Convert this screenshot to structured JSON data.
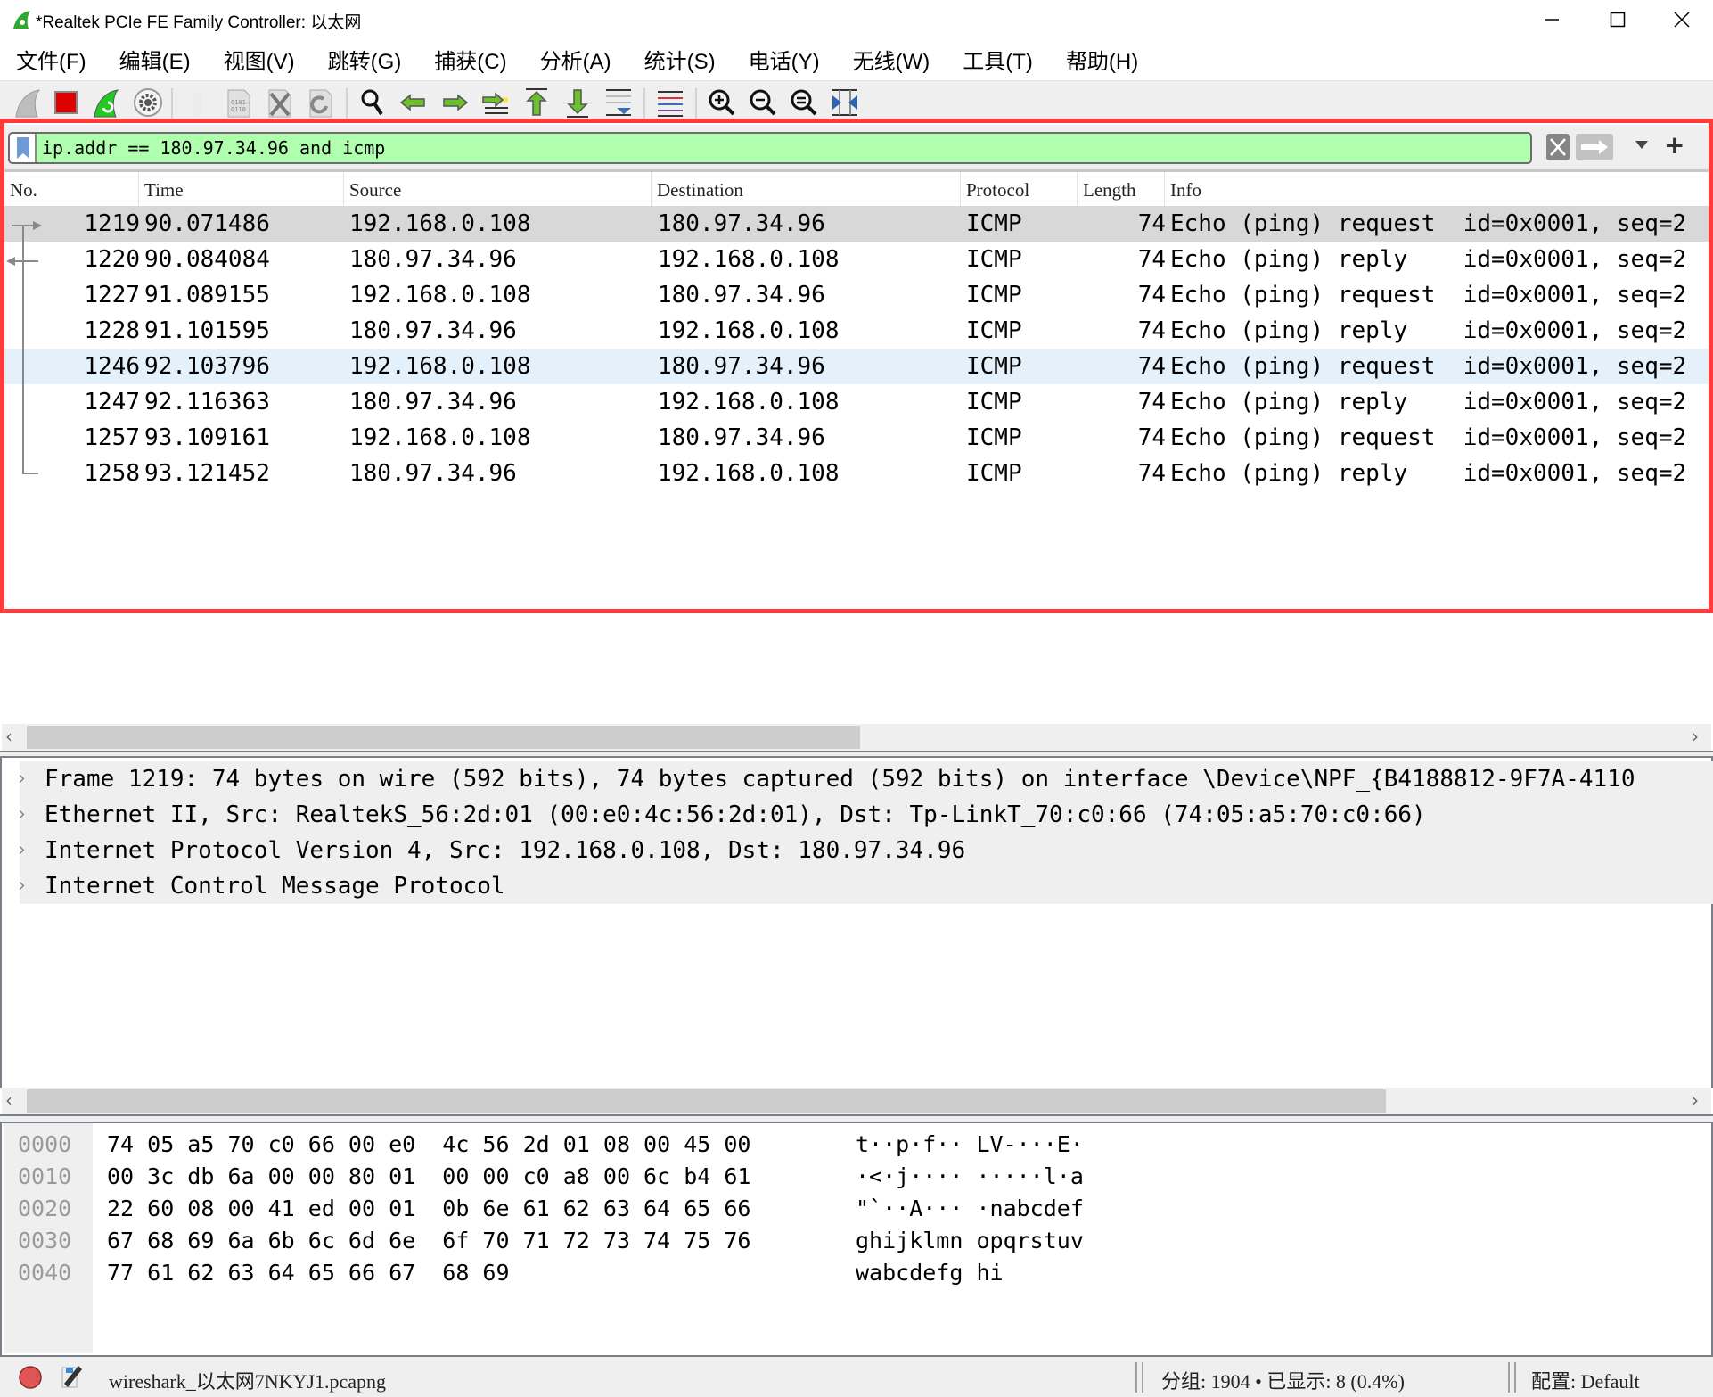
{
  "window": {
    "title": "*Realtek PCIe FE Family Controller: 以太网",
    "controls": {
      "minimize": "minimize",
      "maximize": "maximize",
      "close": "close"
    }
  },
  "menu": [
    {
      "label": "文件(F)"
    },
    {
      "label": "编辑(E)"
    },
    {
      "label": "视图(V)"
    },
    {
      "label": "跳转(G)"
    },
    {
      "label": "捕获(C)"
    },
    {
      "label": "分析(A)"
    },
    {
      "label": "统计(S)"
    },
    {
      "label": "电话(Y)"
    },
    {
      "label": "无线(W)"
    },
    {
      "label": "工具(T)"
    },
    {
      "label": "帮助(H)"
    }
  ],
  "toolbar": {
    "icons": [
      "start-capture-icon",
      "stop-capture-icon",
      "restart-capture-icon",
      "capture-options-icon",
      "open-file-icon",
      "save-file-icon",
      "close-file-icon",
      "reload-file-icon",
      "find-packet-icon",
      "go-back-icon",
      "go-forward-icon",
      "go-to-packet-icon",
      "go-first-packet-icon",
      "go-last-packet-icon",
      "auto-scroll-icon",
      "colorize-icon",
      "zoom-in-icon",
      "zoom-out-icon",
      "zoom-normal-icon",
      "resize-columns-icon"
    ]
  },
  "filter": {
    "value": "ip.addr == 180.97.34.96 and icmp",
    "bg_color": "#afffaf",
    "add_label": "+"
  },
  "packet_list": {
    "columns": [
      "No.",
      "Time",
      "Source",
      "Destination",
      "Protocol",
      "Length",
      "Info"
    ],
    "rows": [
      {
        "no": "1219",
        "time": "90.071486",
        "src": "192.168.0.108",
        "dst": "180.97.34.96",
        "proto": "ICMP",
        "len": "74",
        "info": "Echo (ping) request  id=0x0001, seq=2"
      },
      {
        "no": "1220",
        "time": "90.084084",
        "src": "180.97.34.96",
        "dst": "192.168.0.108",
        "proto": "ICMP",
        "len": "74",
        "info": "Echo (ping) reply    id=0x0001, seq=2"
      },
      {
        "no": "1227",
        "time": "91.089155",
        "src": "192.168.0.108",
        "dst": "180.97.34.96",
        "proto": "ICMP",
        "len": "74",
        "info": "Echo (ping) request  id=0x0001, seq=2"
      },
      {
        "no": "1228",
        "time": "91.101595",
        "src": "180.97.34.96",
        "dst": "192.168.0.108",
        "proto": "ICMP",
        "len": "74",
        "info": "Echo (ping) reply    id=0x0001, seq=2"
      },
      {
        "no": "1246",
        "time": "92.103796",
        "src": "192.168.0.108",
        "dst": "180.97.34.96",
        "proto": "ICMP",
        "len": "74",
        "info": "Echo (ping) request  id=0x0001, seq=2"
      },
      {
        "no": "1247",
        "time": "92.116363",
        "src": "180.97.34.96",
        "dst": "192.168.0.108",
        "proto": "ICMP",
        "len": "74",
        "info": "Echo (ping) reply    id=0x0001, seq=2"
      },
      {
        "no": "1257",
        "time": "93.109161",
        "src": "192.168.0.108",
        "dst": "180.97.34.96",
        "proto": "ICMP",
        "len": "74",
        "info": "Echo (ping) request  id=0x0001, seq=2"
      },
      {
        "no": "1258",
        "time": "93.121452",
        "src": "180.97.34.96",
        "dst": "192.168.0.108",
        "proto": "ICMP",
        "len": "74",
        "info": "Echo (ping) reply    id=0x0001, seq=2"
      }
    ],
    "selected_row": "1219",
    "hover_row": "1246"
  },
  "details": [
    {
      "text": "Frame 1219: 74 bytes on wire (592 bits), 74 bytes captured (592 bits) on interface \\Device\\NPF_{B4188812-9F7A-4110"
    },
    {
      "text": "Ethernet II, Src: RealtekS_56:2d:01 (00:e0:4c:56:2d:01), Dst: Tp-LinkT_70:c0:66 (74:05:a5:70:c0:66)"
    },
    {
      "text": "Internet Protocol Version 4, Src: 192.168.0.108, Dst: 180.97.34.96"
    },
    {
      "text": "Internet Control Message Protocol"
    }
  ],
  "hex": [
    {
      "offset": "0000",
      "bytes": "74 05 a5 70 c0 66 00 e0  4c 56 2d 01 08 00 45 00",
      "ascii": "t··p·f·· LV-···E·"
    },
    {
      "offset": "0010",
      "bytes": "00 3c db 6a 00 00 80 01  00 00 c0 a8 00 6c b4 61",
      "ascii": "·<·j···· ·····l·a"
    },
    {
      "offset": "0020",
      "bytes": "22 60 08 00 41 ed 00 01  0b 6e 61 62 63 64 65 66",
      "ascii": "\"`··A··· ·nabcdef"
    },
    {
      "offset": "0030",
      "bytes": "67 68 69 6a 6b 6c 6d 6e  6f 70 71 72 73 74 75 76",
      "ascii": "ghijklmn opqrstuv"
    },
    {
      "offset": "0040",
      "bytes": "77 61 62 63 64 65 66 67  68 69",
      "ascii": "wabcdefg hi"
    }
  ],
  "status": {
    "file": "wireshark_以太网7NKYJ1.pcapng",
    "packets": "分组: 1904 • 已显示: 8 (0.4%)",
    "profile": "配置: Default"
  }
}
